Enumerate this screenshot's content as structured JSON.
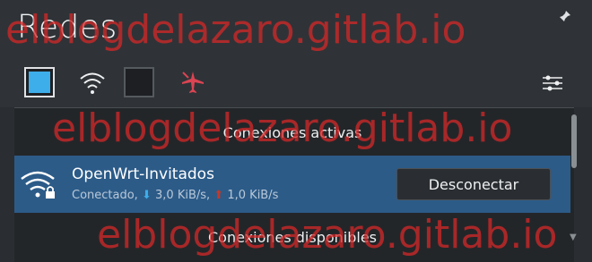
{
  "window": {
    "title": "Redes"
  },
  "toolbar": {
    "buttons": [
      {
        "icon": "ethernet-toggle-icon",
        "state": "on"
      },
      {
        "icon": "wifi-icon"
      },
      {
        "icon": "mobile-toggle-icon",
        "state": "off"
      },
      {
        "icon": "airplane-mode-icon"
      },
      {
        "icon": "network-settings-icon"
      }
    ]
  },
  "sections": {
    "active": "Conexiones activas",
    "available": "Conexiones disponibles"
  },
  "active_connection": {
    "name": "OpenWrt-Invitados",
    "status": "Conectado,",
    "down_arrow": "⬇",
    "down_speed": "3,0 KiB/s,",
    "up_arrow": "⬆",
    "up_speed": "1,0 KiB/s",
    "disconnect_label": "Desconectar"
  },
  "watermark": "elblogdelazaro.gitlab.io",
  "colors": {
    "accent": "#3daee9",
    "selected_row": "#2c5b88",
    "watermark": "#d62828"
  }
}
